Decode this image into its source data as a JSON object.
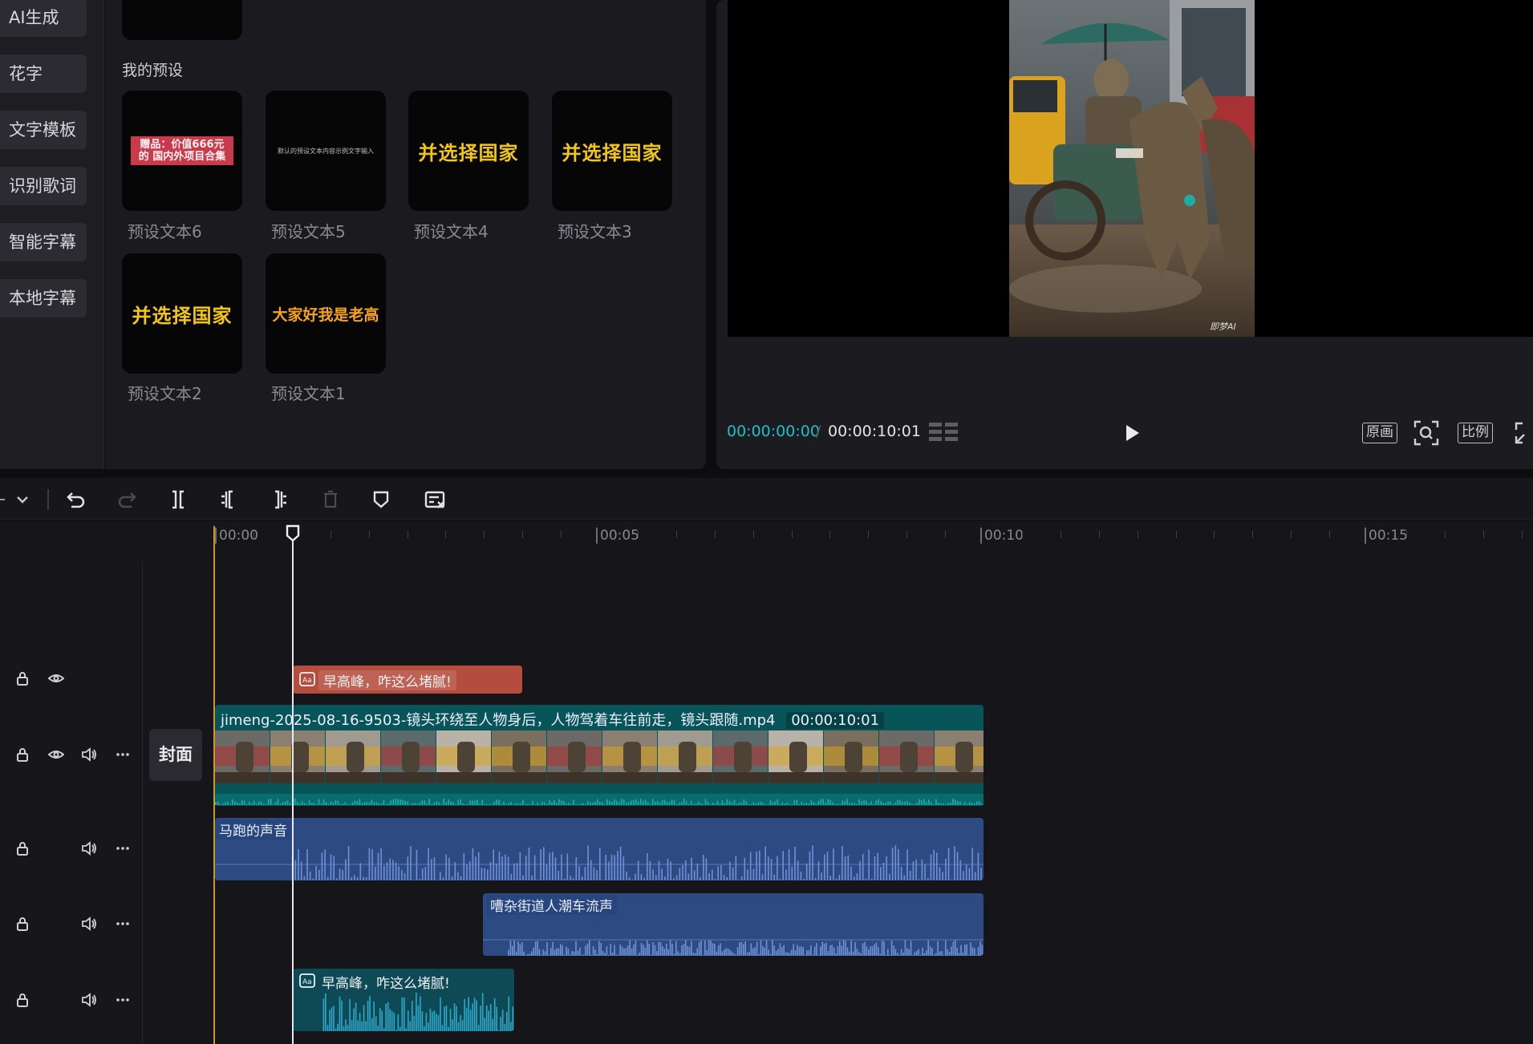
{
  "sidebar": {
    "items": [
      {
        "label": "AI生成"
      },
      {
        "label": "花字"
      },
      {
        "label": "文字模板"
      },
      {
        "label": "识别歌词"
      },
      {
        "label": "智能字幕"
      },
      {
        "label": "本地字幕"
      }
    ]
  },
  "presets": {
    "heading": "我的预设",
    "items": [
      {
        "caption": "预设文本6",
        "preview": "赠品：价值666元的 国内外项目合集"
      },
      {
        "caption": "预设文本5",
        "preview": "默认的预设文本内容示例文字输入"
      },
      {
        "caption": "预设文本4",
        "preview": "并选择国家"
      },
      {
        "caption": "预设文本3",
        "preview": "并选择国家"
      },
      {
        "caption": "预设文本2",
        "preview": "并选择国家"
      },
      {
        "caption": "预设文本1",
        "preview": "大家好我是老高"
      }
    ]
  },
  "player": {
    "time_current": "00:00:00:00",
    "time_separator": "/",
    "time_total": "00:00:10:01",
    "buttons": {
      "original": "原画",
      "ratio": "比例"
    }
  },
  "timeline": {
    "ruler": [
      "00:00",
      "00:05",
      "00:10",
      "00:15"
    ],
    "text_clip_1": "早高峰，咋这么堵腻!",
    "video_clip": {
      "filename": "jimeng-2025-08-16-9503-镜头环绕至人物身后，人物驾着车往前走，镜头跟随.mp4",
      "duration": "00:00:10:01"
    },
    "cover_label": "封面",
    "audio_1": "马跑的声音",
    "audio_2": "嘈杂街道人潮车流声",
    "text_clip_2": "早高峰，咋这么堵腻!"
  },
  "colors": {
    "accent_cyan": "#1fc1c9",
    "text_clip": "#b44d3d",
    "video_clip": "#075559",
    "audio_clip": "#2d4a83",
    "tts_clip": "#0d4a55",
    "preset_yellow": "#f3c614"
  }
}
